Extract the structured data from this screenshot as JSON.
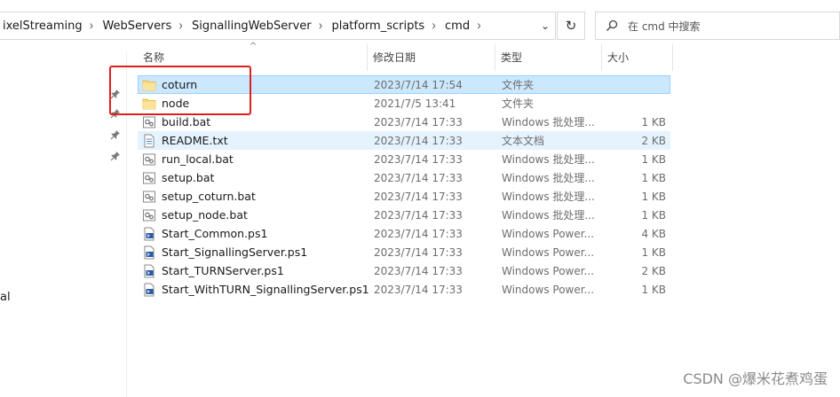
{
  "breadcrumb": [
    "ixelStreaming",
    "WebServers",
    "SignallingWebServer",
    "platform_scripts",
    "cmd"
  ],
  "search": {
    "placeholder": "在 cmd 中搜索"
  },
  "nav": {
    "partial_label": "al"
  },
  "columns": {
    "name": "名称",
    "date": "修改日期",
    "type": "类型",
    "size": "大小"
  },
  "files": [
    {
      "name": "coturn",
      "date": "2023/7/14 17:54",
      "type": "文件夹",
      "size": "",
      "icon": "folder-icon",
      "state": "selected"
    },
    {
      "name": "node",
      "date": "2021/7/5 13:41",
      "type": "文件夹",
      "size": "",
      "icon": "folder-icon",
      "state": ""
    },
    {
      "name": "build.bat",
      "date": "2023/7/14 17:33",
      "type": "Windows 批处理...",
      "size": "1 KB",
      "icon": "batch-file-icon",
      "state": ""
    },
    {
      "name": "README.txt",
      "date": "2023/7/14 17:33",
      "type": "文本文档",
      "size": "2 KB",
      "icon": "text-file-icon",
      "state": "hover"
    },
    {
      "name": "run_local.bat",
      "date": "2023/7/14 17:33",
      "type": "Windows 批处理...",
      "size": "1 KB",
      "icon": "batch-file-icon",
      "state": ""
    },
    {
      "name": "setup.bat",
      "date": "2023/7/14 17:33",
      "type": "Windows 批处理...",
      "size": "1 KB",
      "icon": "batch-file-icon",
      "state": ""
    },
    {
      "name": "setup_coturn.bat",
      "date": "2023/7/14 17:33",
      "type": "Windows 批处理...",
      "size": "1 KB",
      "icon": "batch-file-icon",
      "state": ""
    },
    {
      "name": "setup_node.bat",
      "date": "2023/7/14 17:33",
      "type": "Windows 批处理...",
      "size": "1 KB",
      "icon": "batch-file-icon",
      "state": ""
    },
    {
      "name": "Start_Common.ps1",
      "date": "2023/7/14 17:33",
      "type": "Windows Power...",
      "size": "4 KB",
      "icon": "powershell-file-icon",
      "state": ""
    },
    {
      "name": "Start_SignallingServer.ps1",
      "date": "2023/7/14 17:33",
      "type": "Windows Power...",
      "size": "1 KB",
      "icon": "powershell-file-icon",
      "state": ""
    },
    {
      "name": "Start_TURNServer.ps1",
      "date": "2023/7/14 17:33",
      "type": "Windows Power...",
      "size": "2 KB",
      "icon": "powershell-file-icon",
      "state": ""
    },
    {
      "name": "Start_WithTURN_SignallingServer.ps1",
      "date": "2023/7/14 17:33",
      "type": "Windows Power...",
      "size": "1 KB",
      "icon": "powershell-file-icon",
      "state": ""
    }
  ],
  "watermark": "CSDN @爆米花煮鸡蛋",
  "colors": {
    "selection": "#cce8ff",
    "hover": "#e5f3ff",
    "annotation": "#e01e1e",
    "folder": "#f8d775"
  }
}
